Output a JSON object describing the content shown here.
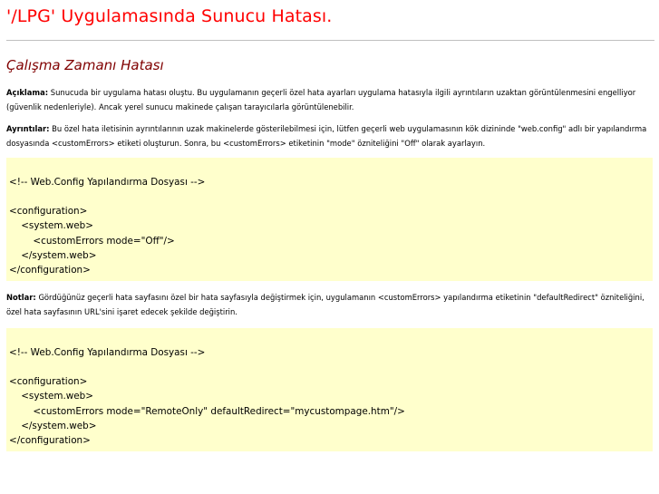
{
  "title": "'/LPG' Uygulamasında Sunucu Hatası.",
  "subtitle": "Çalışma Zamanı Hatası",
  "description": {
    "label": "Açıklama:",
    "text": " Sunucuda bir uygulama hatası oluştu. Bu uygulamanın geçerli özel hata ayarları uygulama hatasıyla ilgili ayrıntıların uzaktan görüntülenmesini engelliyor (güvenlik nedenleriyle). Ancak yerel sunucu makinede çalışan tarayıcılarla görüntülenebilir."
  },
  "details": {
    "label": "Ayrıntılar:",
    "text": " Bu özel hata iletisinin ayrıntılarının uzak makinelerde gösterilebilmesi için, lütfen geçerli web uygulamasının kök dizininde \"web.config\" adlı bir yapılandırma dosyasında <customErrors> etiketi oluşturun. Sonra, bu <customErrors> etiketinin \"mode\" özniteliğini \"Off\" olarak ayarlayın."
  },
  "code_block_1": {
    "lines": [
      "<!-- Web.Config Yapılandırma Dosyası -->",
      "",
      "<configuration>",
      "    <system.web>",
      "        <customErrors mode=\"Off\"/>",
      "    </system.web>",
      "</configuration>"
    ]
  },
  "notes": {
    "label": "Notlar:",
    "text": " Gördüğünüz geçerli hata sayfasını özel bir hata sayfasıyla değiştirmek için, uygulamanın <customErrors> yapılandırma etiketinin \"defaultRedirect\" özniteliğini, özel hata sayfasının URL'sini işaret edecek şekilde değiştirin."
  },
  "code_block_2": {
    "lines": [
      "<!-- Web.Config Yapılandırma Dosyası -->",
      "",
      "<configuration>",
      "    <system.web>",
      "        <customErrors mode=\"RemoteOnly\" defaultRedirect=\"mycustompage.htm\"/>",
      "    </system.web>",
      "</configuration>"
    ]
  },
  "colors": {
    "title": "#ff0000",
    "subtitle": "#800000",
    "code_background": "#ffffcc",
    "rule": "#c0c0c0"
  }
}
